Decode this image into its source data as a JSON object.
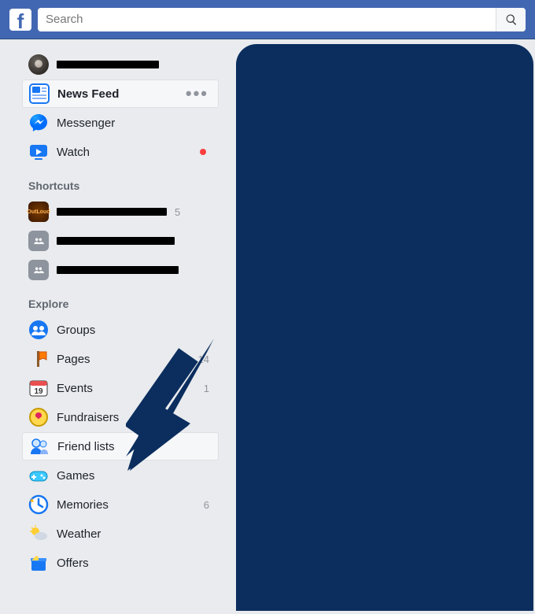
{
  "colors": {
    "brand": "#4267b2",
    "overlay": "#0b2e5e",
    "notif": "#fa3e3e"
  },
  "search": {
    "placeholder": "Search"
  },
  "profile": {
    "name_redacted_width": 130
  },
  "nav": {
    "news_feed": "News Feed",
    "messenger": "Messenger",
    "watch": "Watch"
  },
  "sections": {
    "shortcuts": "Shortcuts",
    "explore": "Explore"
  },
  "shortcuts": [
    {
      "style": "orange",
      "redacted_width": 140,
      "count": "5"
    },
    {
      "style": "gray",
      "redacted_width": 150,
      "count": ""
    },
    {
      "style": "gray",
      "redacted_width": 155,
      "count": ""
    }
  ],
  "explore": {
    "groups": {
      "label": "Groups",
      "count": ""
    },
    "pages": {
      "label": "Pages",
      "count": "14"
    },
    "events": {
      "label": "Events",
      "count": "1"
    },
    "fundraisers": {
      "label": "Fundraisers",
      "count": ""
    },
    "friend_lists": {
      "label": "Friend lists",
      "count": ""
    },
    "games": {
      "label": "Games",
      "count": ""
    },
    "memories": {
      "label": "Memories",
      "count": "6"
    },
    "weather": {
      "label": "Weather",
      "count": ""
    },
    "offers": {
      "label": "Offers",
      "count": ""
    }
  }
}
